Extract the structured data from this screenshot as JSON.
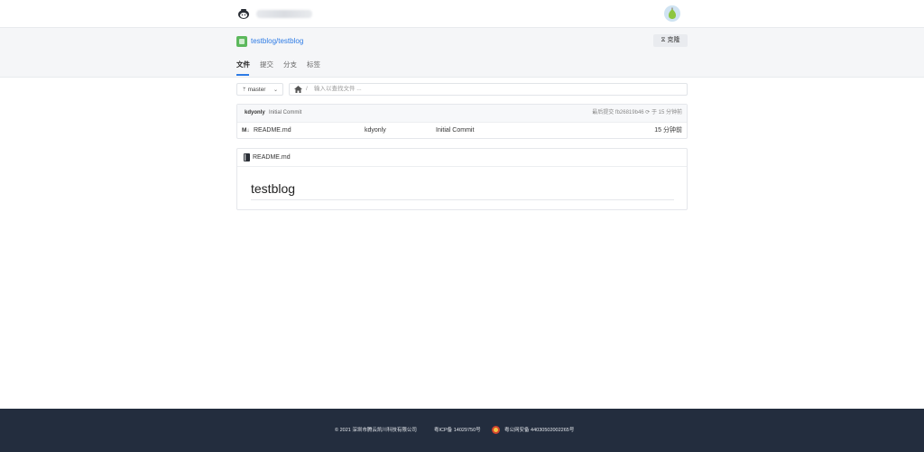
{
  "header": {
    "logo_icon": "gitee-mascot-icon",
    "avatar_icon": "pear-avatar-icon"
  },
  "repo": {
    "name": "testblog/testblog",
    "clone_label": "克隆",
    "clone_icon": "download-icon"
  },
  "tabs": [
    {
      "label": "文件",
      "active": true
    },
    {
      "label": "提交",
      "active": false
    },
    {
      "label": "分支",
      "active": false
    },
    {
      "label": "标签",
      "active": false
    }
  ],
  "toolbar": {
    "branch": "master",
    "path_placeholder": "输入以查找文件 ..."
  },
  "commit": {
    "author": "kdyonly",
    "message": "Initial Commit",
    "meta": "最后提交  fb26819b46  ⟳  于 15 分钟前"
  },
  "files": [
    {
      "icon": "M↓",
      "name": "README.md",
      "author": "kdyonly",
      "message": "Initial Commit",
      "time": "15 分钟前"
    }
  ],
  "readme": {
    "filename": "README.md",
    "title": "testblog"
  },
  "footer": {
    "copyright": "© 2021 深圳市腾云凯川科技有限公司",
    "icp": "粤ICP备 14029750号",
    "police": "粤公网安备 44030502002265号"
  },
  "colors": {
    "accent": "#2d7be5",
    "footer_bg": "#232d3e",
    "header_bg": "#f5f6f8"
  }
}
